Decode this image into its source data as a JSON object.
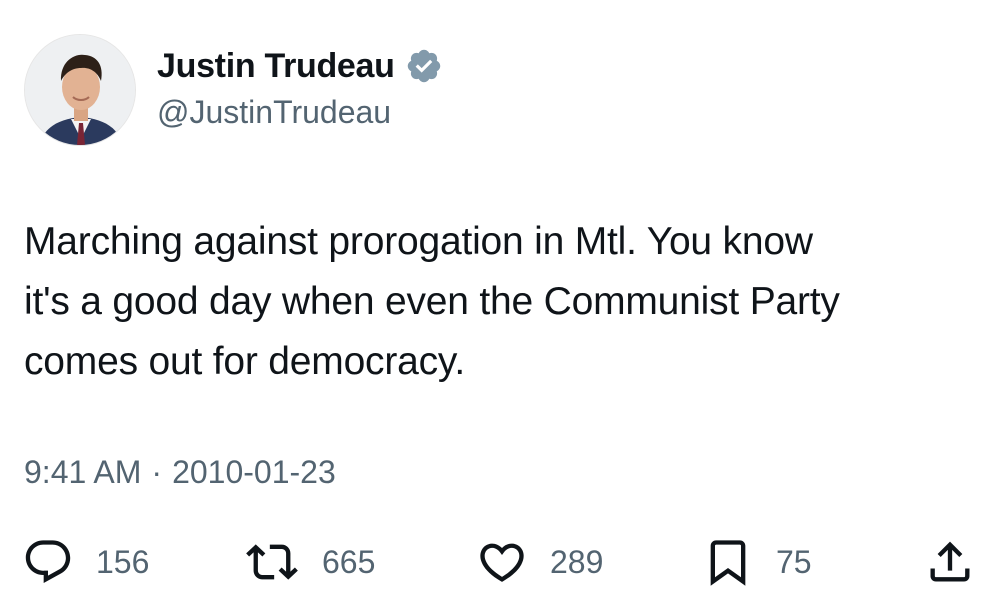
{
  "author": {
    "display_name": "Justin Trudeau",
    "handle": "@JustinTrudeau",
    "verified": true,
    "verified_color": "#829aab"
  },
  "tweet": {
    "text_lines": [
      "Marching against prorogation in Mtl. You know",
      "it's a good day when even the Communist Party",
      "comes out for democracy."
    ],
    "time": "9:41 AM",
    "separator": "·",
    "date": "2010-01-23"
  },
  "actions": {
    "replies": "156",
    "retweets": "665",
    "likes": "289",
    "bookmarks": "75"
  },
  "icons": {
    "reply": "speech-bubble-icon",
    "retweet": "retweet-arrows-icon",
    "like": "heart-icon",
    "bookmark": "bookmark-icon",
    "share": "share-upload-icon",
    "verified": "verified-badge-icon"
  },
  "colors": {
    "text_primary": "#0f1419",
    "text_secondary": "#536471",
    "background": "#ffffff"
  }
}
